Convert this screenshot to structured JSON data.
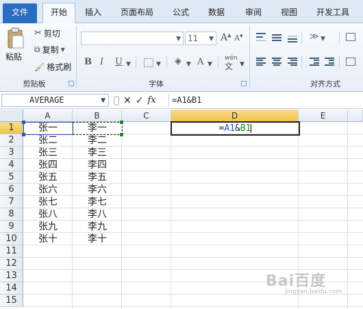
{
  "tabs": [
    "文件",
    "开始",
    "插入",
    "页面布局",
    "公式",
    "数据",
    "审阅",
    "视图",
    "开发工具"
  ],
  "ribbon": {
    "paste_label": "粘贴",
    "cut_label": "剪切",
    "copy_label": "复制",
    "format_painter_label": "格式刷",
    "clipboard_group": "剪贴板",
    "font_group": "字体",
    "alignment_group": "对齐方式",
    "font_size": "11",
    "font_name": "",
    "bold": "B",
    "italic": "I",
    "underline": "U",
    "grow_font": "A",
    "shrink_font": "A",
    "font_color": "A",
    "wen": "wén"
  },
  "formula_bar": {
    "name_box": "AVERAGE",
    "formula": "=A1&B1",
    "fx": "fx"
  },
  "columns": [
    "A",
    "B",
    "C",
    "D",
    "E"
  ],
  "rows": [
    "1",
    "2",
    "3",
    "4",
    "5",
    "6",
    "7",
    "8",
    "9",
    "10",
    "11",
    "12",
    "13",
    "14",
    "15"
  ],
  "col_a": [
    "张一",
    "张二",
    "张三",
    "张四",
    "张五",
    "张六",
    "张七",
    "张八",
    "张九",
    "张十"
  ],
  "col_b": [
    "李一",
    "李二",
    "李三",
    "李四",
    "李五",
    "李六",
    "李七",
    "李八",
    "李九",
    "李十"
  ],
  "d1": {
    "eq": "=",
    "ref1": "A1",
    "amp": "&",
    "ref2": "B1",
    "ref1_color": "#2a52be",
    "ref2_color": "#1e8a1e"
  },
  "watermark": "Bai百度",
  "watermark_sub": "jingyan.baidu.com"
}
